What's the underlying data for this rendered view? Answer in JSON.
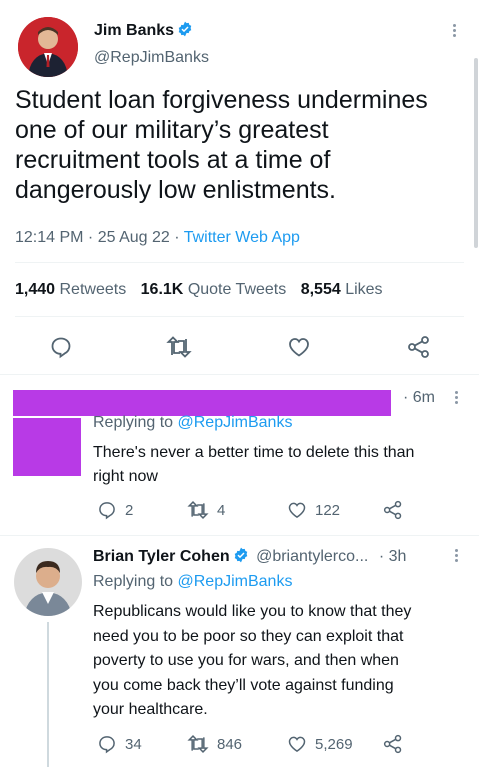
{
  "main_tweet": {
    "author_name": "Jim Banks",
    "handle": "@RepJimBanks",
    "text_lines": [
      "Student loan forgiveness undermines",
      "one of our military’s greatest",
      "recruitment tools at a time of",
      "dangerously low enlistments."
    ],
    "time": "12:14 PM",
    "date": "25 Aug 22",
    "source": "Twitter Web App",
    "retweets_count": "1,440",
    "retweets_label": "Retweets",
    "quotes_count": "16.1K",
    "quotes_label": "Quote Tweets",
    "likes_count": "8,554",
    "likes_label": "Likes"
  },
  "reply1": {
    "age": "6m",
    "replying_prefix": "Replying to",
    "replying_handle": "@RepJimBanks",
    "text_lines": [
      "There's never a better time to delete this than",
      "right now"
    ],
    "replies": "2",
    "retweets": "4",
    "likes": "122",
    "redaction_color": "#b83ae6"
  },
  "reply2": {
    "author_name": "Brian Tyler Cohen",
    "handle": "@briantylerco...",
    "age": "3h",
    "replying_prefix": "Replying to",
    "replying_handle": "@RepJimBanks",
    "text_lines": [
      "Republicans would like you to know that they",
      "need you to be poor so they can exploit that",
      "poverty to use you for wars, and then when",
      "you come back they’ll vote against funding",
      "your healthcare."
    ],
    "replies": "34",
    "retweets": "846",
    "likes": "5,269"
  },
  "colors": {
    "accent": "#1d9bf0",
    "text": "#0f1419",
    "secondary": "#536471"
  }
}
